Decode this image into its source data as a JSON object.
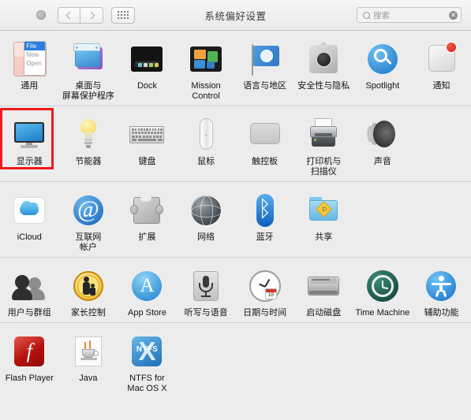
{
  "window": {
    "title": "系统偏好设置"
  },
  "toolbar": {
    "back_label": "‹",
    "forward_label": "›",
    "grid_label": "显示全部",
    "search_placeholder": "搜索",
    "search_value": "",
    "clear_label": "✕"
  },
  "rows": [
    {
      "id": "personal",
      "panes": [
        {
          "id": "general",
          "icon": "general-icon",
          "label": "通用",
          "label_lines": [
            "通用"
          ]
        },
        {
          "id": "desktop",
          "icon": "desktop-screensaver-icon",
          "label": "桌面与屏幕保护程序",
          "label_lines": [
            "桌面与",
            "屏幕保护程序"
          ]
        },
        {
          "id": "dock",
          "icon": "dock-icon",
          "label": "Dock",
          "label_lines": [
            "Dock"
          ]
        },
        {
          "id": "mission",
          "icon": "mission-control-icon",
          "label": "Mission Control",
          "label_lines": [
            "Mission",
            "Control"
          ]
        },
        {
          "id": "language",
          "icon": "language-region-icon",
          "label": "语言与地区",
          "label_lines": [
            "语言与地区"
          ]
        },
        {
          "id": "security",
          "icon": "security-privacy-icon",
          "label": "安全性与隐私",
          "label_lines": [
            "安全性与隐私"
          ]
        },
        {
          "id": "spotlight",
          "icon": "spotlight-icon",
          "label": "Spotlight",
          "label_lines": [
            "Spotlight"
          ]
        },
        {
          "id": "notifications",
          "icon": "notifications-icon",
          "label": "通知",
          "label_lines": [
            "通知"
          ],
          "badge": true
        }
      ]
    },
    {
      "id": "hardware",
      "panes": [
        {
          "id": "displays",
          "icon": "displays-icon",
          "label": "显示器",
          "label_lines": [
            "显示器"
          ],
          "highlighted": true
        },
        {
          "id": "energy",
          "icon": "energy-saver-icon",
          "label": "节能器",
          "label_lines": [
            "节能器"
          ]
        },
        {
          "id": "keyboard",
          "icon": "keyboard-icon",
          "label": "键盘",
          "label_lines": [
            "键盘"
          ]
        },
        {
          "id": "mouse",
          "icon": "mouse-icon",
          "label": "鼠标",
          "label_lines": [
            "鼠标"
          ]
        },
        {
          "id": "trackpad",
          "icon": "trackpad-icon",
          "label": "触控板",
          "label_lines": [
            "触控板"
          ]
        },
        {
          "id": "printers",
          "icon": "printers-scanners-icon",
          "label": "打印机与扫描仪",
          "label_lines": [
            "打印机与",
            "扫描仪"
          ]
        },
        {
          "id": "sound",
          "icon": "sound-icon",
          "label": "声音",
          "label_lines": [
            "声音"
          ]
        }
      ]
    },
    {
      "id": "internet",
      "panes": [
        {
          "id": "icloud",
          "icon": "icloud-icon",
          "label": "iCloud",
          "label_lines": [
            "iCloud"
          ]
        },
        {
          "id": "accounts",
          "icon": "internet-accounts-icon",
          "label": "互联网帐户",
          "label_lines": [
            "互联网",
            "帐户"
          ]
        },
        {
          "id": "extensions",
          "icon": "extensions-icon",
          "label": "扩展",
          "label_lines": [
            "扩展"
          ]
        },
        {
          "id": "network",
          "icon": "network-icon",
          "label": "网络",
          "label_lines": [
            "网络"
          ]
        },
        {
          "id": "bluetooth",
          "icon": "bluetooth-icon",
          "label": "蓝牙",
          "label_lines": [
            "蓝牙"
          ]
        },
        {
          "id": "sharing",
          "icon": "sharing-icon",
          "label": "共享",
          "label_lines": [
            "共享"
          ]
        }
      ]
    },
    {
      "id": "system",
      "panes": [
        {
          "id": "users",
          "icon": "users-groups-icon",
          "label": "用户与群组",
          "label_lines": [
            "用户与群组"
          ]
        },
        {
          "id": "parental",
          "icon": "parental-controls-icon",
          "label": "家长控制",
          "label_lines": [
            "家长控制"
          ]
        },
        {
          "id": "appstore",
          "icon": "app-store-icon",
          "label": "App Store",
          "label_lines": [
            "App Store"
          ]
        },
        {
          "id": "dictation",
          "icon": "dictation-speech-icon",
          "label": "听写与语音",
          "label_lines": [
            "听写与语音"
          ]
        },
        {
          "id": "datetime",
          "icon": "date-time-icon",
          "label": "日期与时间",
          "label_lines": [
            "日期与时间"
          ],
          "calendar_day": "18"
        },
        {
          "id": "startup",
          "icon": "startup-disk-icon",
          "label": "启动磁盘",
          "label_lines": [
            "启动磁盘"
          ]
        },
        {
          "id": "timemachine",
          "icon": "time-machine-icon",
          "label": "Time Machine",
          "label_lines": [
            "Time Machine"
          ]
        },
        {
          "id": "access",
          "icon": "accessibility-icon",
          "label": "辅助功能",
          "label_lines": [
            "辅助功能"
          ]
        }
      ]
    },
    {
      "id": "other",
      "panes": [
        {
          "id": "flash",
          "icon": "flash-player-icon",
          "label": "Flash Player",
          "label_lines": [
            "Flash Player"
          ]
        },
        {
          "id": "java",
          "icon": "java-icon",
          "label": "Java",
          "label_lines": [
            "Java"
          ]
        },
        {
          "id": "ntfs",
          "icon": "ntfs-icon",
          "label": "NTFS for Mac OS X",
          "label_lines": [
            "NTFS for",
            "Mac OS X"
          ],
          "badge_text": "NTFS"
        }
      ]
    }
  ],
  "general_icon_text": {
    "menu_title": "File",
    "item1": "New",
    "item2": "Open"
  },
  "colors": {
    "highlight": "#ef1a1a",
    "window_bg": "#ececec",
    "toolbar_bg": "#f2f2f2",
    "separator": "#d2d2d2",
    "badge_red": "#cf1710",
    "accent_blue": "#1c7fd0"
  }
}
